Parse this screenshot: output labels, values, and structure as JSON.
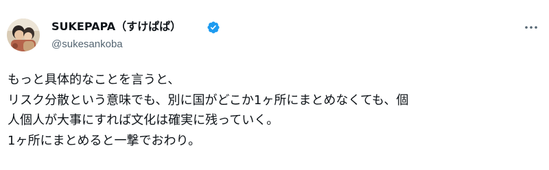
{
  "tweet": {
    "author": {
      "display_name": "SUKEPAPA（すけぱぱ）",
      "handle": "@sukesankoba",
      "verified": true,
      "verified_color": "#1d9bf0",
      "avatar_icon": "profile-photo"
    },
    "more_icon": "more-horizontal-icon",
    "text_lines": [
      "もっと具体的なことを言うと、",
      "リスク分散という意味でも、別に国がどこか1ヶ所にまとめなくても、個",
      "人個人が大事にすれば文化は確実に残っていく。",
      "1ヶ所にまとめると一撃でおわり。"
    ]
  }
}
